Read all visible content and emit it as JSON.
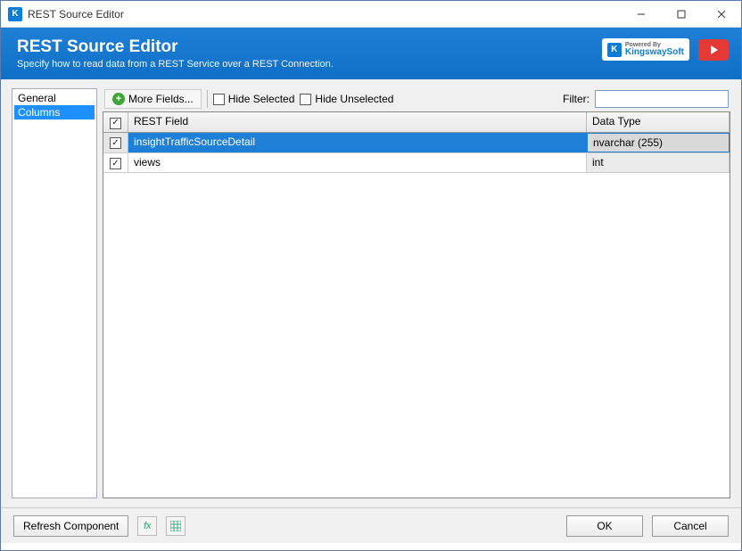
{
  "window": {
    "title": "REST Source Editor"
  },
  "header": {
    "title": "REST Source Editor",
    "subtitle": "Specify how to read data from a REST Service over a REST Connection.",
    "brand_powered": "Powered By",
    "brand_name": "KingswaySoft"
  },
  "sidebar": {
    "items": [
      {
        "label": "General",
        "selected": false
      },
      {
        "label": "Columns",
        "selected": true
      }
    ]
  },
  "toolbar": {
    "more_fields": "More Fields...",
    "hide_selected": "Hide Selected",
    "hide_unselected": "Hide Unselected",
    "filter_label": "Filter:",
    "filter_value": ""
  },
  "grid": {
    "columns": {
      "field": "REST Field",
      "type": "Data Type"
    },
    "rows": [
      {
        "checked": true,
        "field": "insightTrafficSourceDetail",
        "type": "nvarchar (255)",
        "selected": true
      },
      {
        "checked": true,
        "field": "views",
        "type": "int",
        "selected": false
      }
    ]
  },
  "footer": {
    "refresh": "Refresh Component",
    "fx_tip": "fx",
    "ok": "OK",
    "cancel": "Cancel"
  }
}
